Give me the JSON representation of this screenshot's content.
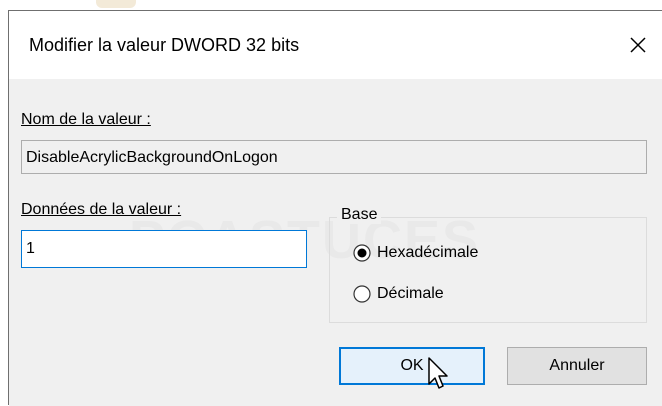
{
  "dialog": {
    "title": "Modifier la valeur DWORD 32 bits",
    "name_label": "Nom de la valeur :",
    "name_value": "DisableAcrylicBackgroundOnLogon",
    "data_label": "Données de la valeur :",
    "data_value": "1",
    "base_label": "Base",
    "radio_hex": "Hexadécimale",
    "radio_dec": "Décimale",
    "hex_selected": true,
    "ok_label": "OK",
    "cancel_label": "Annuler",
    "watermark_text": "PCASTUCES",
    "accent_color": "#0078d7"
  }
}
